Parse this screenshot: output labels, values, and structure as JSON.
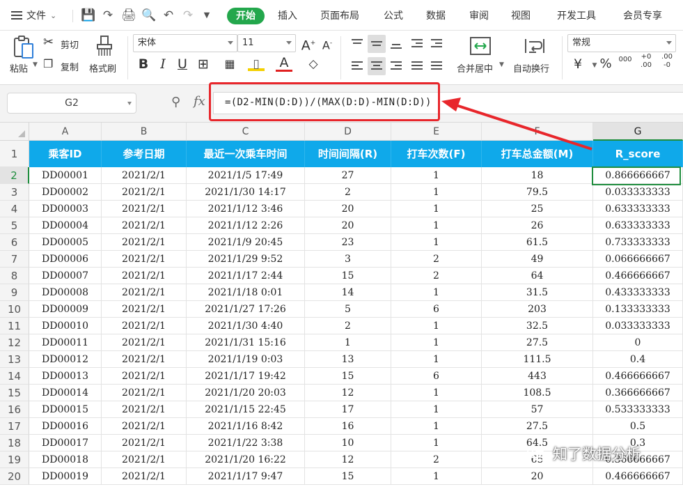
{
  "menu": {
    "file_label": "文件",
    "tabs": [
      "开始",
      "插入",
      "页面布局",
      "公式",
      "数据",
      "审阅",
      "视图",
      "开发工具",
      "会员专享"
    ]
  },
  "ribbon": {
    "paste": "粘贴",
    "cut": "剪切",
    "copy": "复制",
    "format_painter": "格式刷",
    "font_name": "宋体",
    "font_size": "11",
    "merge_center": "合并居中",
    "wrap_text": "自动换行",
    "number_format": "常规"
  },
  "formula_bar": {
    "name_box": "G2",
    "fx_label": "fx",
    "formula": "=(D2-MIN(D:D))/(MAX(D:D)-MIN(D:D))"
  },
  "sheet": {
    "columns": [
      "A",
      "B",
      "C",
      "D",
      "E",
      "F",
      "G"
    ],
    "row_numbers": [
      "1",
      "2",
      "3",
      "4",
      "5",
      "6",
      "7",
      "8",
      "9",
      "10",
      "11",
      "12",
      "13",
      "14",
      "15",
      "16",
      "17",
      "18",
      "19",
      "20"
    ],
    "headers": [
      "乘客ID",
      "参考日期",
      "最近一次乘车时间",
      "时间间隔(R)",
      "打车次数(F)",
      "打车总金额(M)",
      "R_score"
    ],
    "rows": [
      [
        "DD00001",
        "2021/2/1",
        "2021/1/5 17:49",
        "27",
        "1",
        "18",
        "0.866666667"
      ],
      [
        "DD00002",
        "2021/2/1",
        "2021/1/30 14:17",
        "2",
        "1",
        "79.5",
        "0.033333333"
      ],
      [
        "DD00003",
        "2021/2/1",
        "2021/1/12 3:46",
        "20",
        "1",
        "25",
        "0.633333333"
      ],
      [
        "DD00004",
        "2021/2/1",
        "2021/1/12 2:26",
        "20",
        "1",
        "26",
        "0.633333333"
      ],
      [
        "DD00005",
        "2021/2/1",
        "2021/1/9 20:45",
        "23",
        "1",
        "61.5",
        "0.733333333"
      ],
      [
        "DD00006",
        "2021/2/1",
        "2021/1/29 9:52",
        "3",
        "2",
        "49",
        "0.066666667"
      ],
      [
        "DD00007",
        "2021/2/1",
        "2021/1/17 2:44",
        "15",
        "2",
        "64",
        "0.466666667"
      ],
      [
        "DD00008",
        "2021/2/1",
        "2021/1/18 0:01",
        "14",
        "1",
        "31.5",
        "0.433333333"
      ],
      [
        "DD00009",
        "2021/2/1",
        "2021/1/27 17:26",
        "5",
        "6",
        "203",
        "0.133333333"
      ],
      [
        "DD00010",
        "2021/2/1",
        "2021/1/30 4:40",
        "2",
        "1",
        "32.5",
        "0.033333333"
      ],
      [
        "DD00011",
        "2021/2/1",
        "2021/1/31 15:16",
        "1",
        "1",
        "27.5",
        "0"
      ],
      [
        "DD00012",
        "2021/2/1",
        "2021/1/19 0:03",
        "13",
        "1",
        "111.5",
        "0.4"
      ],
      [
        "DD00013",
        "2021/2/1",
        "2021/1/17 19:42",
        "15",
        "6",
        "443",
        "0.466666667"
      ],
      [
        "DD00014",
        "2021/2/1",
        "2021/1/20 20:03",
        "12",
        "1",
        "108.5",
        "0.366666667"
      ],
      [
        "DD00015",
        "2021/2/1",
        "2021/1/15 22:45",
        "17",
        "1",
        "57",
        "0.533333333"
      ],
      [
        "DD00016",
        "2021/2/1",
        "2021/1/16 8:42",
        "16",
        "1",
        "27.5",
        "0.5"
      ],
      [
        "DD00017",
        "2021/2/1",
        "2021/1/22 3:38",
        "10",
        "1",
        "64.5",
        "0.3"
      ],
      [
        "DD00018",
        "2021/2/1",
        "2021/1/20 16:22",
        "12",
        "2",
        "65",
        "0.366666667"
      ],
      [
        "DD00019",
        "2021/2/1",
        "2021/1/17 9:47",
        "15",
        "1",
        "20",
        "0.466666667"
      ]
    ]
  },
  "watermark": "知了数据分析",
  "colors": {
    "accent": "#23a74c",
    "header_fill": "#0fa9ea",
    "highlight": "#e8262b",
    "selection": "#1f8d3e"
  }
}
